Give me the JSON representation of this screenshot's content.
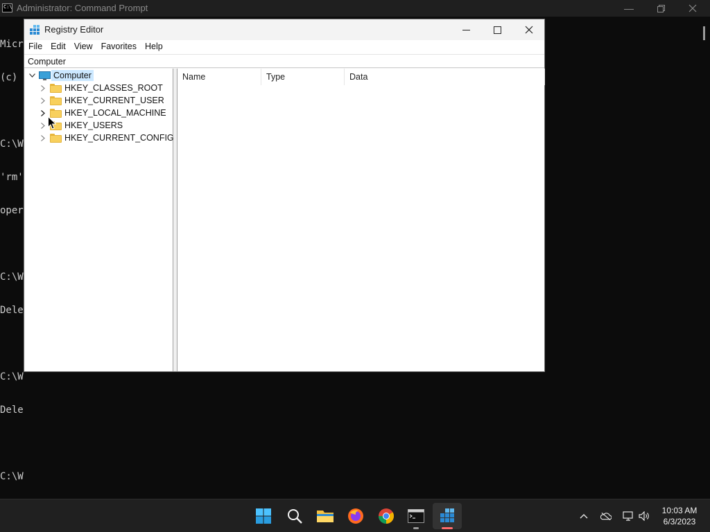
{
  "cmd_window": {
    "title": "Administrator: Command Prompt",
    "lines": [
      "Micr",
      "(c) ",
      "",
      "C:\\W",
      "'rm'",
      "oper",
      "",
      "C:\\W",
      "Dele",
      "",
      "C:\\W",
      "Dele",
      "",
      "C:\\W"
    ]
  },
  "regedit": {
    "title": "Registry Editor",
    "menu": [
      "File",
      "Edit",
      "View",
      "Favorites",
      "Help"
    ],
    "address": "Computer",
    "tree": {
      "root": "Computer",
      "children": [
        "HKEY_CLASSES_ROOT",
        "HKEY_CURRENT_USER",
        "HKEY_LOCAL_MACHINE",
        "HKEY_USERS",
        "HKEY_CURRENT_CONFIG"
      ]
    },
    "columns": [
      "Name",
      "Type",
      "Data"
    ]
  },
  "taskbar": {
    "apps": [
      "start-icon",
      "search-icon",
      "file-explorer-icon",
      "firefox-icon",
      "chrome-icon",
      "terminal-icon",
      "registry-editor-icon"
    ],
    "clock_time": "10:03 AM",
    "clock_date": "6/3/2023",
    "accent": "#ff6b6b"
  }
}
